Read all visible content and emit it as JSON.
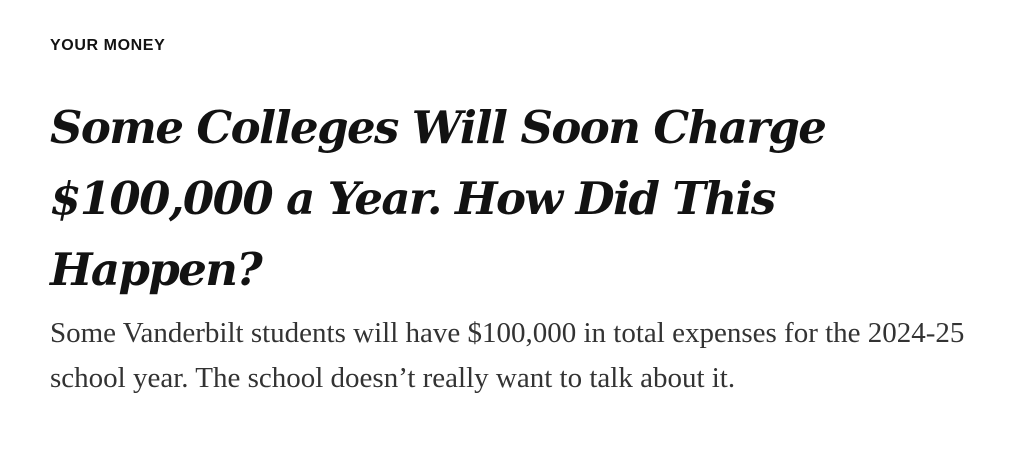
{
  "section": {
    "label": "YOUR MONEY"
  },
  "headline": {
    "text": "Some Colleges Will Soon Charge $100,000 a Year. How Did This Happen?"
  },
  "summary": {
    "text": "Some Vanderbilt students will have $100,000 in total expenses for the 2024-25 school year. The school doesn’t really want to talk about it."
  },
  "colors": {
    "text_primary": "#121212",
    "text_summary": "#333333",
    "background": "#ffffff"
  }
}
